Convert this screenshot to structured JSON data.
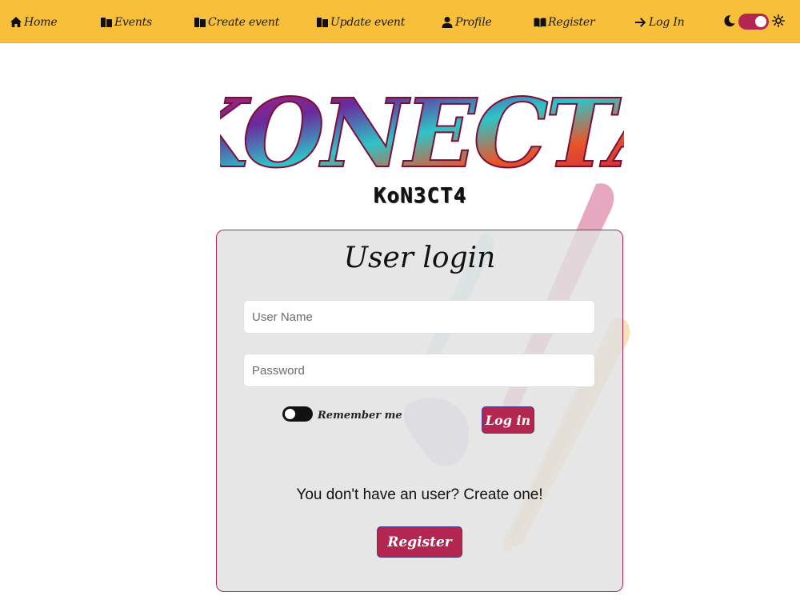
{
  "nav": {
    "home": "Home",
    "events": "Events",
    "create_event": "Create event",
    "update_event": "Update event",
    "profile": "Profile",
    "register": "Register",
    "login": "Log In"
  },
  "theme": {
    "dark_mode_on": true,
    "accent": "#b2264f",
    "navbar_color": "#f8c03a"
  },
  "logo": {
    "text": "KONECTA",
    "subtitle": "KoN3CT4"
  },
  "login_card": {
    "title": "User login",
    "username_placeholder": "User Name",
    "username_value": "",
    "password_placeholder": "Password",
    "password_value": "",
    "remember_label": "Remember me",
    "remember_checked": false,
    "login_button": "Log in",
    "no_user_text": "You don't have an user? Create one!",
    "register_button": "Register"
  }
}
